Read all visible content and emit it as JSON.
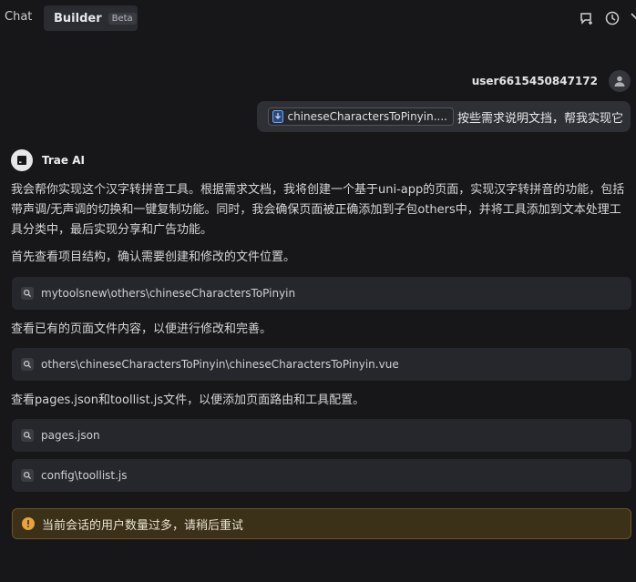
{
  "tabs": {
    "chat": "Chat",
    "builder": "Builder",
    "builder_badge": "Beta"
  },
  "user": {
    "name": "user6615450847172",
    "attached_file": "chineseCharactersToPinyin....",
    "message": "按些需求说明文挡，帮我实现它"
  },
  "assistant": {
    "name": "Trae AI",
    "intro_line1": "我会帮你实现这个汉字转拼音工具。根据需求文档，我将创建一个基于uni-app的页面，实现汉字转拼音的功能，包括",
    "intro_line2": "带声调/无声调的切换和一键复制功能。同时，我会确保页面被正确添加到子包others中，并将工具添加到文本处理工",
    "intro_line3": "具分类中，最后实现分享和广告功能。",
    "step1_text": "首先查看项目结构，确认需要创建和修改的文件位置。",
    "step1_tool": "mytoolsnew\\others\\chineseCharactersToPinyin",
    "step2_text": "查看已有的页面文件内容，以便进行修改和完善。",
    "step2_tool": "others\\chineseCharactersToPinyin\\chineseCharactersToPinyin.vue",
    "step3_text": "查看pages.json和toollist.js文件，以便添加页面路由和工具配置。",
    "step3_tool_a": "pages.json",
    "step3_tool_b": "config\\toollist.js"
  },
  "warning": {
    "message": "当前会话的用户数量过多，请稍后重试"
  },
  "colors": {
    "background": "#17171a",
    "warning_bg": "#3b3018",
    "warning_icon": "#e8a33a",
    "file_icon": "#6aa6ff"
  },
  "icons": {
    "new_chat": "new-chat-icon",
    "history": "history-icon",
    "close": "close-icon",
    "user": "user-icon",
    "search": "search-icon",
    "warning": "warning-icon"
  }
}
